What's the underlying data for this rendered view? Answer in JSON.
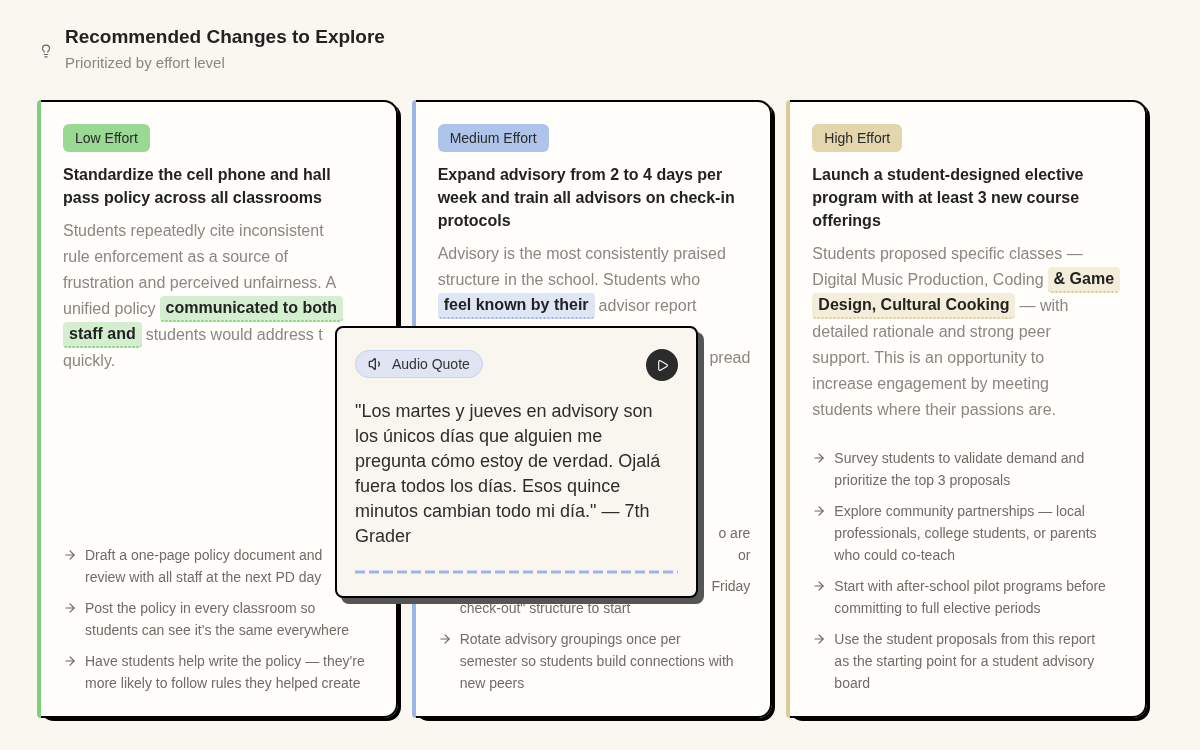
{
  "header": {
    "title": "Recommended Changes to Explore",
    "subtitle": "Prioritized by effort level"
  },
  "cards": [
    {
      "badge": "Low Effort",
      "color": "#7fcf7b",
      "title": "Standardize the cell phone and hall pass policy across all classrooms",
      "body": [
        [
          {
            "kind": "plain",
            "text": "Students repeatedly cite inconsistent"
          }
        ],
        [
          {
            "kind": "plain",
            "text": "rule enforcement as a source of"
          }
        ],
        [
          {
            "kind": "plain",
            "text": "frustration and perceived unfairness. A"
          }
        ],
        [
          {
            "kind": "plain",
            "text": "unified policy"
          },
          {
            "kind": "mark",
            "text": "communicated to both"
          }
        ],
        [
          {
            "kind": "mark",
            "text": "staff and"
          },
          {
            "kind": "plain",
            "text": "students would address t"
          }
        ],
        [
          {
            "kind": "plain",
            "text": "quickly."
          }
        ]
      ],
      "bullets": [
        {
          "arrow": true,
          "lines": [
            "Draft a one-page policy document and",
            "review with all staff at the next PD day"
          ]
        },
        {
          "arrow": true,
          "lines": [
            "Post the policy in every classroom so",
            "students can see it's the same everywhere"
          ]
        },
        {
          "arrow": true,
          "lines": [
            "Have students help write the policy — they're",
            "more likely to follow rules they helped create"
          ]
        }
      ]
    },
    {
      "badge": "Medium Effort",
      "color": "#9bb5e7",
      "title": "Expand advisory from 2 to 4 days per week and train all advisors on check-in protocols",
      "body": [
        [
          {
            "kind": "plain",
            "text": "Advisory is the most consistently praised"
          }
        ],
        [
          {
            "kind": "plain",
            "text": "structure in the school. Students who"
          }
        ],
        [
          {
            "kind": "mark",
            "text": "feel known by their"
          },
          {
            "kind": "plain",
            "text": "advisor report"
          }
        ]
      ],
      "body_fragment": "pread",
      "bullets": [
        {
          "arrow": false,
          "fragments": [
            "o are",
            "or"
          ]
        },
        {
          "arrow": false,
          "fragments": [
            "Friday"
          ],
          "lines": [
            "check-out\" structure to start"
          ]
        },
        {
          "arrow": true,
          "lines": [
            "Rotate advisory groupings once per",
            "semester so students build connections with",
            "new peers"
          ]
        }
      ]
    },
    {
      "badge": "High Effort",
      "color": "#dccb98",
      "title": "Launch a student-designed elective program with at least 3 new course offerings",
      "body": [
        [
          {
            "kind": "plain",
            "text": "Students proposed specific classes —"
          }
        ],
        [
          {
            "kind": "plain",
            "text": "Digital Music Production, Coding"
          },
          {
            "kind": "mark",
            "text": "& Game"
          }
        ],
        [
          {
            "kind": "mark",
            "text": "Design, Cultural Cooking"
          },
          {
            "kind": "plain",
            "text": "— with"
          }
        ],
        [
          {
            "kind": "plain",
            "text": "detailed rationale and strong peer"
          }
        ],
        [
          {
            "kind": "plain",
            "text": "support. This is an opportunity to"
          }
        ],
        [
          {
            "kind": "plain",
            "text": "increase engagement by meeting"
          }
        ],
        [
          {
            "kind": "plain",
            "text": "students where their passions are."
          }
        ]
      ],
      "bullets": [
        {
          "arrow": true,
          "lines": [
            "Survey students to validate demand and",
            "prioritize the top 3 proposals"
          ]
        },
        {
          "arrow": true,
          "lines": [
            "Explore community partnerships — local",
            "professionals, college students, or parents",
            "who could co-teach"
          ]
        },
        {
          "arrow": true,
          "lines": [
            "Start with after-school pilot programs before",
            "committing to full elective periods"
          ]
        },
        {
          "arrow": true,
          "lines": [
            "Use the student proposals from this report",
            "as the starting point for a student advisory",
            "board"
          ]
        }
      ]
    }
  ],
  "popover": {
    "chip": "Audio Quote",
    "quote": "\"Los martes y jueves en advisory son los únicos días que alguien me pregunta cómo estoy de verdad. Ojalá fuera todos los días. Esos quince minutos cambian todo mi día.\" — 7th Grader"
  }
}
